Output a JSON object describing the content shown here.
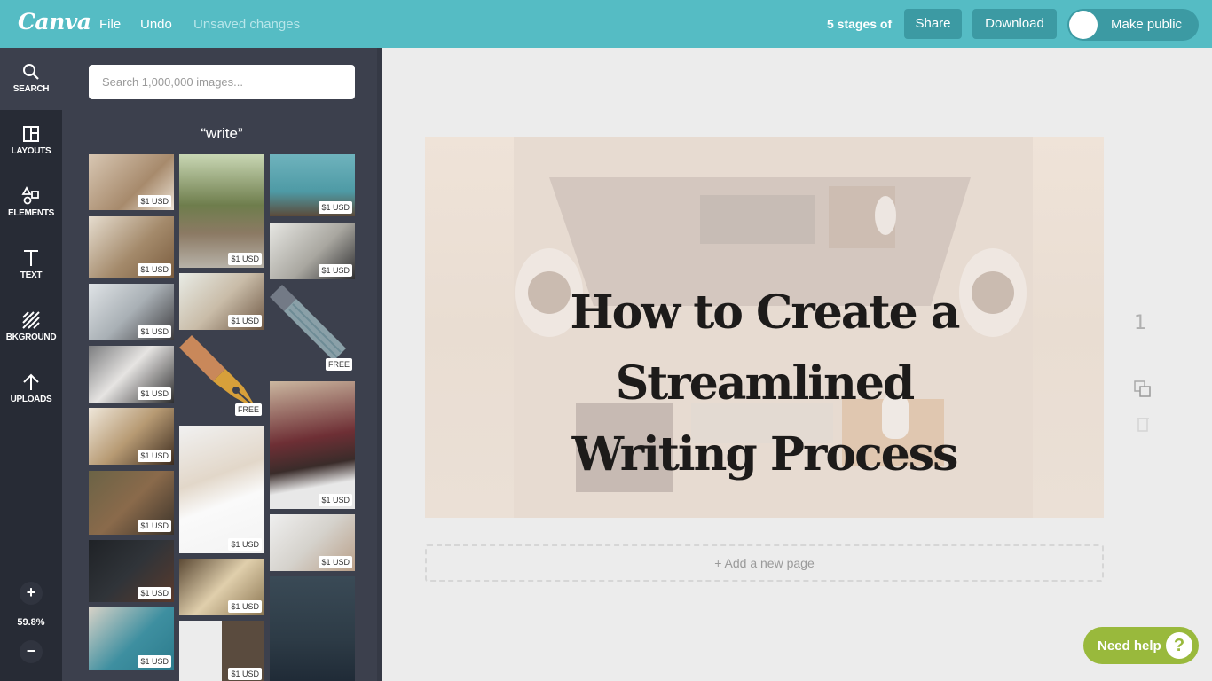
{
  "topbar": {
    "logo": "Canva",
    "file_label": "File",
    "undo_label": "Undo",
    "status": "Unsaved changes",
    "design_title": "5 stages of",
    "share_label": "Share",
    "download_label": "Download",
    "make_public_label": "Make public",
    "make_public_on": false
  },
  "rail": {
    "items": [
      {
        "label": "SEARCH",
        "icon": "search-icon"
      },
      {
        "label": "LAYOUTS",
        "icon": "layouts-icon"
      },
      {
        "label": "ELEMENTS",
        "icon": "elements-icon"
      },
      {
        "label": "TEXT",
        "icon": "text-icon"
      },
      {
        "label": "BKGROUND",
        "icon": "background-icon"
      },
      {
        "label": "UPLOADS",
        "icon": "uploads-icon"
      }
    ],
    "zoom_in": "+",
    "zoom_out": "−",
    "zoom_level": "59.8%"
  },
  "panel": {
    "search_placeholder": "Search 1,000,000 images...",
    "query": "“write”",
    "results": [
      {
        "tag": "$1 USD",
        "desc": "hands writing at desk"
      },
      {
        "tag": "$1 USD",
        "desc": "woman writing at table"
      },
      {
        "tag": "$1 USD",
        "desc": "woman on phone in office"
      },
      {
        "tag": "$1 USD",
        "desc": "desk with laptop top view"
      },
      {
        "tag": "$1 USD",
        "desc": "hands holding notebook"
      },
      {
        "tag": "$1 USD",
        "desc": "person writing on grass"
      },
      {
        "tag": "$1 USD",
        "desc": "chalkboard with easel"
      },
      {
        "tag": "$1 USD",
        "desc": "hand writing on blue"
      },
      {
        "tag": "$1 USD",
        "desc": "man on park bench"
      },
      {
        "tag": "$1 USD",
        "desc": "woman writing with glasses"
      },
      {
        "tag": "FREE",
        "desc": "fountain pen illustration"
      },
      {
        "tag": "$1 USD",
        "desc": "hand writing on white"
      },
      {
        "tag": "$1 USD",
        "desc": "ink bottle and letters"
      },
      {
        "tag": "$1 USD",
        "desc": "typewriter and laptop"
      },
      {
        "tag": "$1 USD",
        "desc": "man writing in teal shirt"
      },
      {
        "tag": "$1 USD",
        "desc": "man in suit writing"
      },
      {
        "tag": "FREE",
        "desc": "pencil illustration"
      },
      {
        "tag": "$1 USD",
        "desc": "man writing at desk"
      },
      {
        "tag": "$1 USD",
        "desc": "coffee cup and writing"
      },
      {
        "tag": "",
        "desc": "woman at chalkboard"
      }
    ]
  },
  "canvas": {
    "headline_line1": "How to Create a Streamlined",
    "headline_line2": "Writing Process",
    "page_number": "1",
    "add_page_label": "+ Add a new page"
  },
  "help": {
    "label": "Need help",
    "icon": "?"
  }
}
